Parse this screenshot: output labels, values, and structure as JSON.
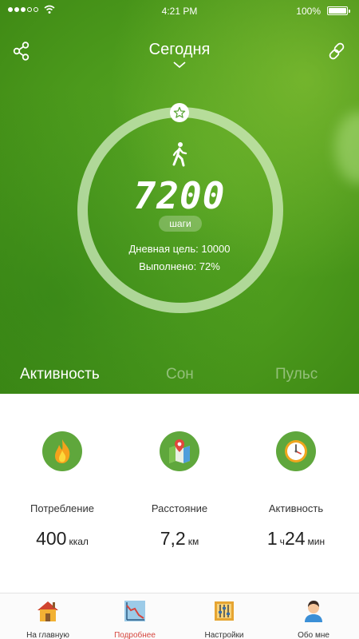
{
  "status_bar": {
    "time": "4:21 PM",
    "battery": "100%",
    "signal_bars_filled": 3,
    "signal_bars_total": 5
  },
  "header": {
    "title": "Сегодня"
  },
  "activity_ring": {
    "steps": "7200",
    "steps_unit": "шаги",
    "daily_goal": "Дневная цель: 10000",
    "completed": "Выполнено: 72%",
    "progress": 0.72
  },
  "tabs": [
    {
      "label": "Активность",
      "active": true
    },
    {
      "label": "Сон",
      "active": false
    },
    {
      "label": "Пульс",
      "active": false
    }
  ],
  "stats": [
    {
      "icon": "flame-icon",
      "label": "Потребление",
      "value": "400",
      "unit": "ккал"
    },
    {
      "icon": "map-icon",
      "label": "Расстояние",
      "value": "7,2",
      "unit": "км"
    },
    {
      "icon": "clock-icon",
      "label": "Активность",
      "value": "1",
      "unit_mid": "ч",
      "value2": "24",
      "unit": "мин"
    }
  ],
  "bottom_nav": [
    {
      "icon": "home-icon",
      "label": "На главную",
      "active": false
    },
    {
      "icon": "chart-icon",
      "label": "Подробнее",
      "active": true
    },
    {
      "icon": "settings-icon",
      "label": "Настройки",
      "active": false
    },
    {
      "icon": "profile-icon",
      "label": "Обо мне",
      "active": false
    }
  ],
  "colors": {
    "accent_green": "#5fa73c",
    "active_nav": "#d6453d"
  }
}
